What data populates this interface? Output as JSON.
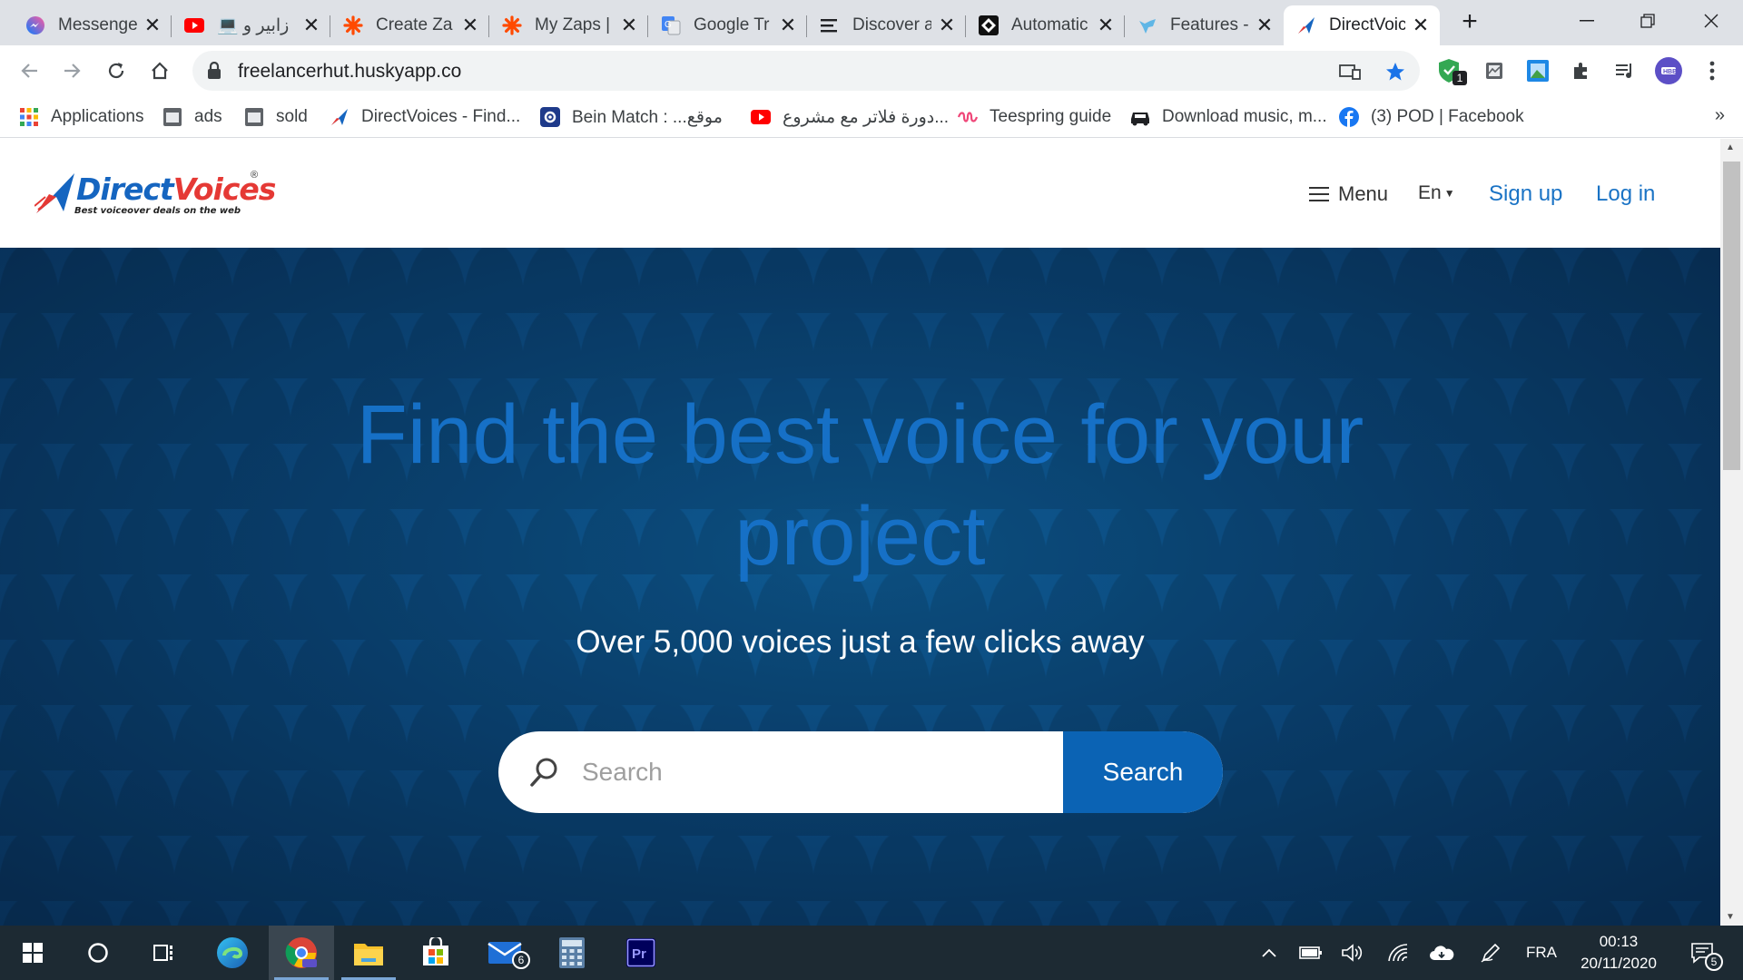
{
  "tabs": [
    {
      "title": "Messenge",
      "icon": "messenger-icon"
    },
    {
      "title": "زابير و 💻",
      "icon": "youtube-icon"
    },
    {
      "title": "Create Za",
      "icon": "zapier-icon"
    },
    {
      "title": "My Zaps |",
      "icon": "zapier-icon"
    },
    {
      "title": "Google Tr",
      "icon": "google-translate-icon"
    },
    {
      "title": "Discover a",
      "icon": "list-icon"
    },
    {
      "title": "Automatic",
      "icon": "automation-icon"
    },
    {
      "title": "Features -",
      "icon": "husky-icon"
    },
    {
      "title": "DirectVoic",
      "icon": "directvoices-icon"
    }
  ],
  "address": {
    "url": "freelancerhut.huskyapp.co"
  },
  "extensions": {
    "badge_count": "1"
  },
  "bookmarks": [
    {
      "label": "Applications",
      "icon": "apps-grid-icon"
    },
    {
      "label": "ads",
      "icon": "folder-icon"
    },
    {
      "label": "sold",
      "icon": "folder-icon"
    },
    {
      "label": "DirectVoices - Find...",
      "icon": "directvoices-icon"
    },
    {
      "label": "Bein Match : ...موقع",
      "icon": "gear-icon"
    },
    {
      "label": "دورة فلاتر مع مشروع...",
      "icon": "youtube-icon"
    },
    {
      "label": "Teespring guide",
      "icon": "teespring-icon"
    },
    {
      "label": "Download music, m...",
      "icon": "car-icon"
    },
    {
      "label": "(3) POD | Facebook",
      "icon": "facebook-icon"
    }
  ],
  "site": {
    "logo": {
      "name_blue": "Direct",
      "name_red": "Voices",
      "reg": "®",
      "tagline": "Best voiceover deals on the web"
    },
    "nav": {
      "menu": "Menu",
      "lang": "En",
      "signup": "Sign up",
      "login": "Log in"
    },
    "hero": {
      "title": "Find the best voice for your project",
      "subtitle": "Over 5,000 voices just a few clicks away",
      "search_placeholder": "Search",
      "search_button": "Search"
    }
  },
  "taskbar": {
    "mail_badge": "6",
    "lang": "FRA",
    "time": "00:13",
    "date": "20/11/2020",
    "notifications": "5"
  },
  "colors": {
    "brand_blue": "#1670c6",
    "search_button": "#0b63b4",
    "hero_bg": "#0b4577"
  }
}
